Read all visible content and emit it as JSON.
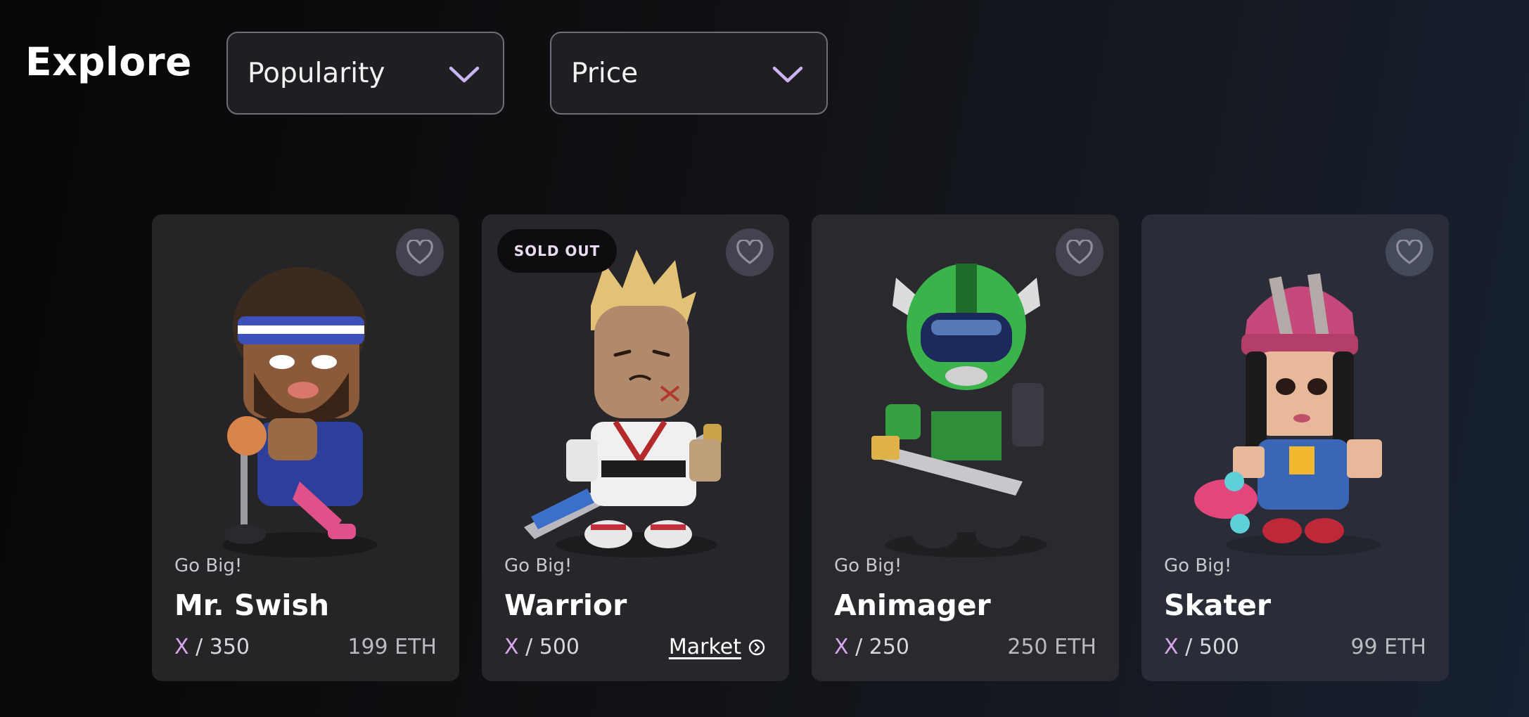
{
  "header": {
    "title": "Explore"
  },
  "filters": {
    "sort": {
      "value": "Popularity",
      "icon": "chevron-down-icon"
    },
    "price": {
      "value": "Price",
      "icon": "chevron-down-icon"
    }
  },
  "cards": [
    {
      "collection": "Go Big!",
      "name": "Mr. Swish",
      "edition_x": "X",
      "edition_total": "/ 350",
      "price": "199 ETH"
    },
    {
      "collection": "Go Big!",
      "name": "Warrior",
      "edition_x": "X",
      "edition_total": "/ 500",
      "badge": "SOLD OUT",
      "market_label": "Market"
    },
    {
      "collection": "Go Big!",
      "name": "Animager",
      "edition_x": "X",
      "edition_total": "/ 250",
      "price": "250 ETH"
    },
    {
      "collection": "Go Big!",
      "name": "Skater",
      "edition_x": "X",
      "edition_total": "/ 500",
      "price": "99 ETH"
    }
  ],
  "colors": {
    "accent_lavender": "#c9b6f0",
    "edition_pink": "#d9a6ee",
    "card_bg": "#27272b"
  }
}
